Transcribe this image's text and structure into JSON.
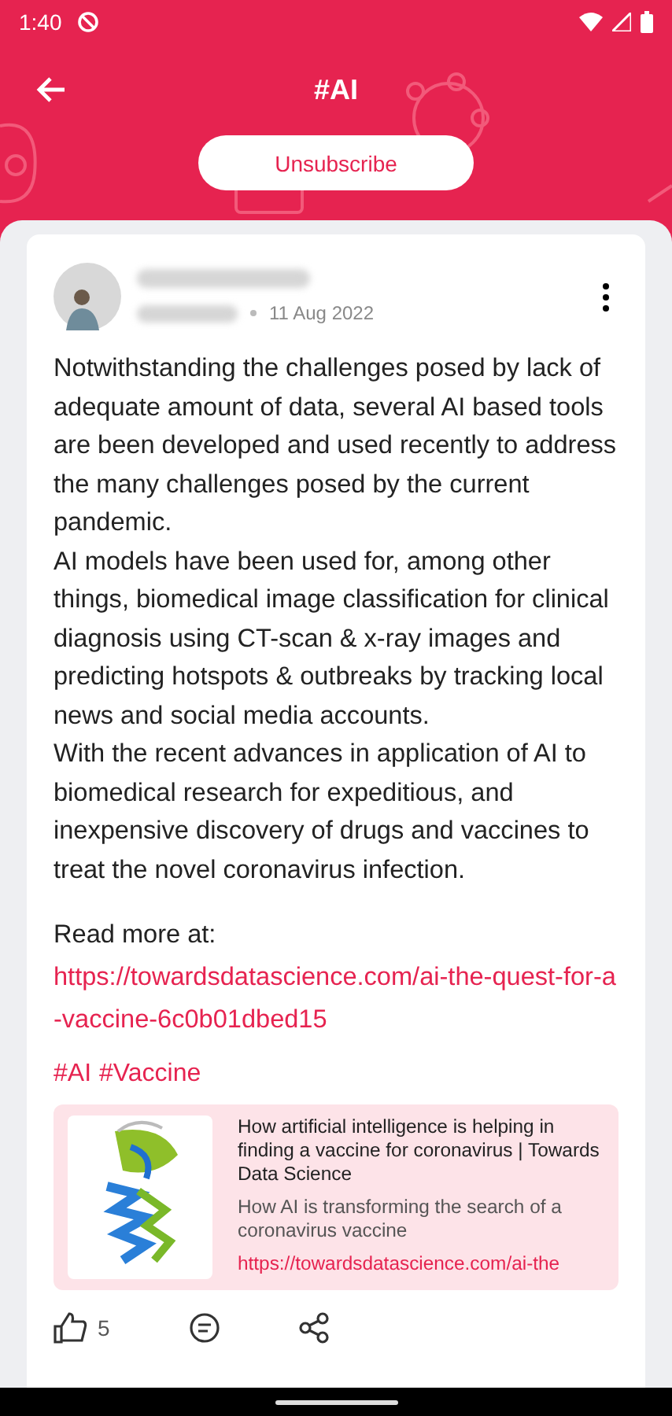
{
  "status_bar": {
    "time": "1:40"
  },
  "header": {
    "title": "#AI",
    "button": "Unsubscribe"
  },
  "post": {
    "date": "11 Aug 2022",
    "paragraphs": [
      "Notwithstanding the challenges posed by lack of adequate amount of data, several AI based tools are been developed and used recently to address the many challenges posed by the current pandemic.",
      "AI models have been used for, among other things, biomedical image classification for clinical diagnosis using CT-scan & x-ray images and predicting hotspots & outbreaks by tracking local news and social media accounts.",
      "With the recent advances in application of AI to biomedical research for expeditious, and inexpensive discovery of drugs and vaccines to treat the novel coronavirus infection."
    ],
    "read_more_label": "Read more at:",
    "read_more_link": "https://towardsdatascience.com/ai-the-quest-for-a-vaccine-6c0b01dbed15",
    "hashtags": [
      "#AI",
      "#Vaccine"
    ],
    "preview": {
      "title": "How artificial intelligence is helping in finding a vaccine for coronavirus | Towards Data Science",
      "description": "How AI is transforming the search of a coronavirus vaccine",
      "url": "https://towardsdatascience.com/ai-the"
    },
    "likes": "5"
  }
}
